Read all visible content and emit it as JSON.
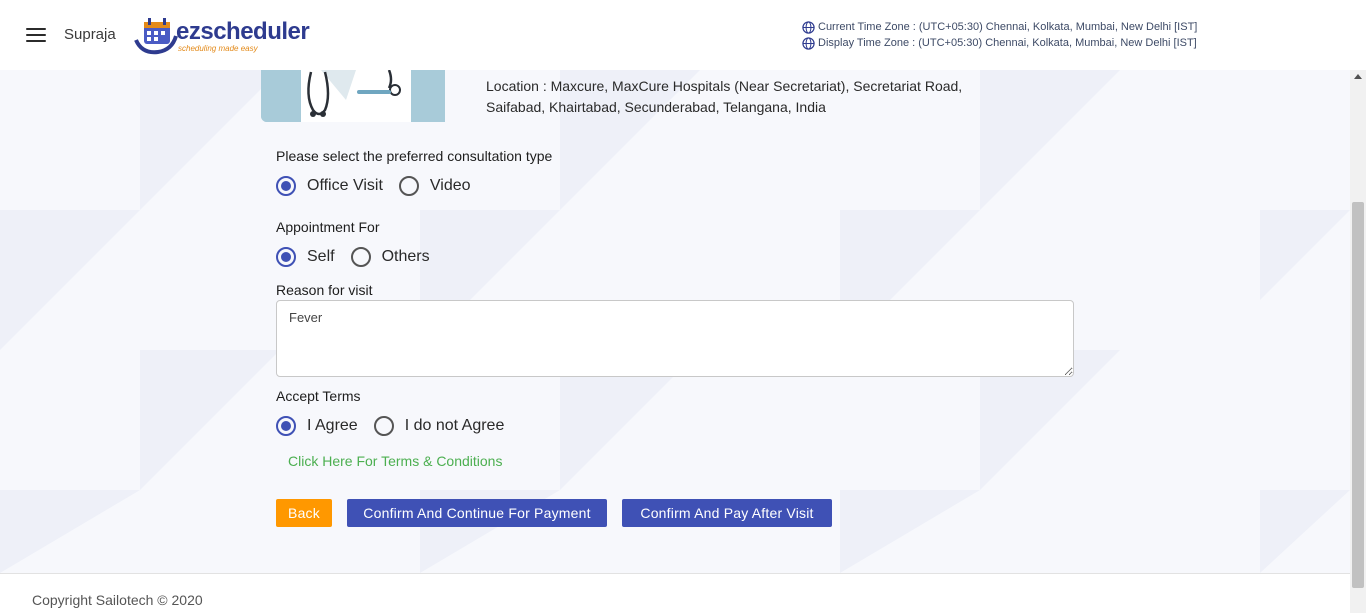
{
  "header": {
    "user_name": "Supraja",
    "logo_text": "ezscheduler",
    "logo_tagline": "scheduling made easy",
    "current_time_zone": "Current Time Zone : (UTC+05:30) Chennai, Kolkata, Mumbai, New Delhi [IST]",
    "display_time_zone": "Display Time Zone : (UTC+05:30) Chennai, Kolkata, Mumbai, New Delhi [IST]"
  },
  "doctor": {
    "location_line1": "Location : Maxcure, MaxCure Hospitals (Near Secretariat), Secretariat Road,",
    "location_line2": "Saifabad, Khairtabad, Secunderabad, Telangana, India"
  },
  "form": {
    "consultation_label": "Please select the preferred consultation type",
    "consultation_options": [
      {
        "label": "Office Visit",
        "checked": true
      },
      {
        "label": "Video",
        "checked": false
      }
    ],
    "appointment_label": "Appointment For",
    "appointment_options": [
      {
        "label": "Self",
        "checked": true
      },
      {
        "label": "Others",
        "checked": false
      }
    ],
    "reason_label": "Reason for visit",
    "reason_value": "Fever",
    "terms_label": "Accept Terms",
    "terms_options": [
      {
        "label": "I Agree",
        "checked": true
      },
      {
        "label": "I do not Agree",
        "checked": false
      }
    ],
    "terms_link": "Click Here For Terms & Conditions"
  },
  "buttons": {
    "back": "Back",
    "confirm_payment": "Confirm And Continue For Payment",
    "pay_after_visit": "Confirm And Pay After Visit"
  },
  "footer": {
    "copyright": "Copyright Sailotech © 2020"
  },
  "colors": {
    "primary": "#3f51b5",
    "back_button": "#ff9800",
    "link": "#4caf50"
  }
}
